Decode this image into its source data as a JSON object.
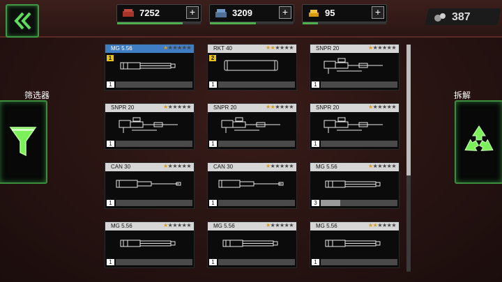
{
  "resources": [
    {
      "name": "armor-plates",
      "value": "7252",
      "fill": 0.78,
      "color": "#c0392b"
    },
    {
      "name": "steel",
      "value": "3209",
      "fill": 0.55,
      "color": "#5c7fa8"
    },
    {
      "name": "gold",
      "value": "95",
      "fill": 0.18,
      "color": "#e6a817"
    }
  ],
  "gems": "387",
  "filter_label": "筛选器",
  "dismantle_label": "拆解",
  "plus": "+",
  "star_char": "★",
  "cards": [
    {
      "name": "MG 5.56",
      "stars": 1,
      "level": "1",
      "qty": "1",
      "fill": 0,
      "type": "mg",
      "selected": true
    },
    {
      "name": "RKT 40",
      "stars": 2,
      "level": "2",
      "qty": "1",
      "fill": 0,
      "type": "rkt",
      "selected": false
    },
    {
      "name": "SNPR 20",
      "stars": 1,
      "level": "",
      "qty": "1",
      "fill": 0,
      "type": "snpr",
      "selected": false
    },
    {
      "name": "SNPR 20",
      "stars": 1,
      "level": "",
      "qty": "1",
      "fill": 0,
      "type": "snpr",
      "selected": false
    },
    {
      "name": "SNPR 20",
      "stars": 2,
      "level": "",
      "qty": "1",
      "fill": 0,
      "type": "snpr",
      "selected": false
    },
    {
      "name": "SNPR 20",
      "stars": 1,
      "level": "",
      "qty": "1",
      "fill": 0,
      "type": "snpr",
      "selected": false
    },
    {
      "name": "CAN 30",
      "stars": 1,
      "level": "",
      "qty": "1",
      "fill": 0,
      "type": "can",
      "selected": false
    },
    {
      "name": "CAN 30",
      "stars": 1,
      "level": "",
      "qty": "1",
      "fill": 0,
      "type": "can",
      "selected": false
    },
    {
      "name": "MG 5.56",
      "stars": 1,
      "level": "",
      "qty": "3",
      "fill": 0.25,
      "type": "mg",
      "selected": false
    },
    {
      "name": "MG 5.56",
      "stars": 1,
      "level": "",
      "qty": "1",
      "fill": 0,
      "type": "mg",
      "selected": false
    },
    {
      "name": "MG 5.56",
      "stars": 1,
      "level": "",
      "qty": "1",
      "fill": 0,
      "type": "mg",
      "selected": false
    },
    {
      "name": "MG 5.56",
      "stars": 2,
      "level": "",
      "qty": "1",
      "fill": 0,
      "type": "mg",
      "selected": false
    }
  ]
}
